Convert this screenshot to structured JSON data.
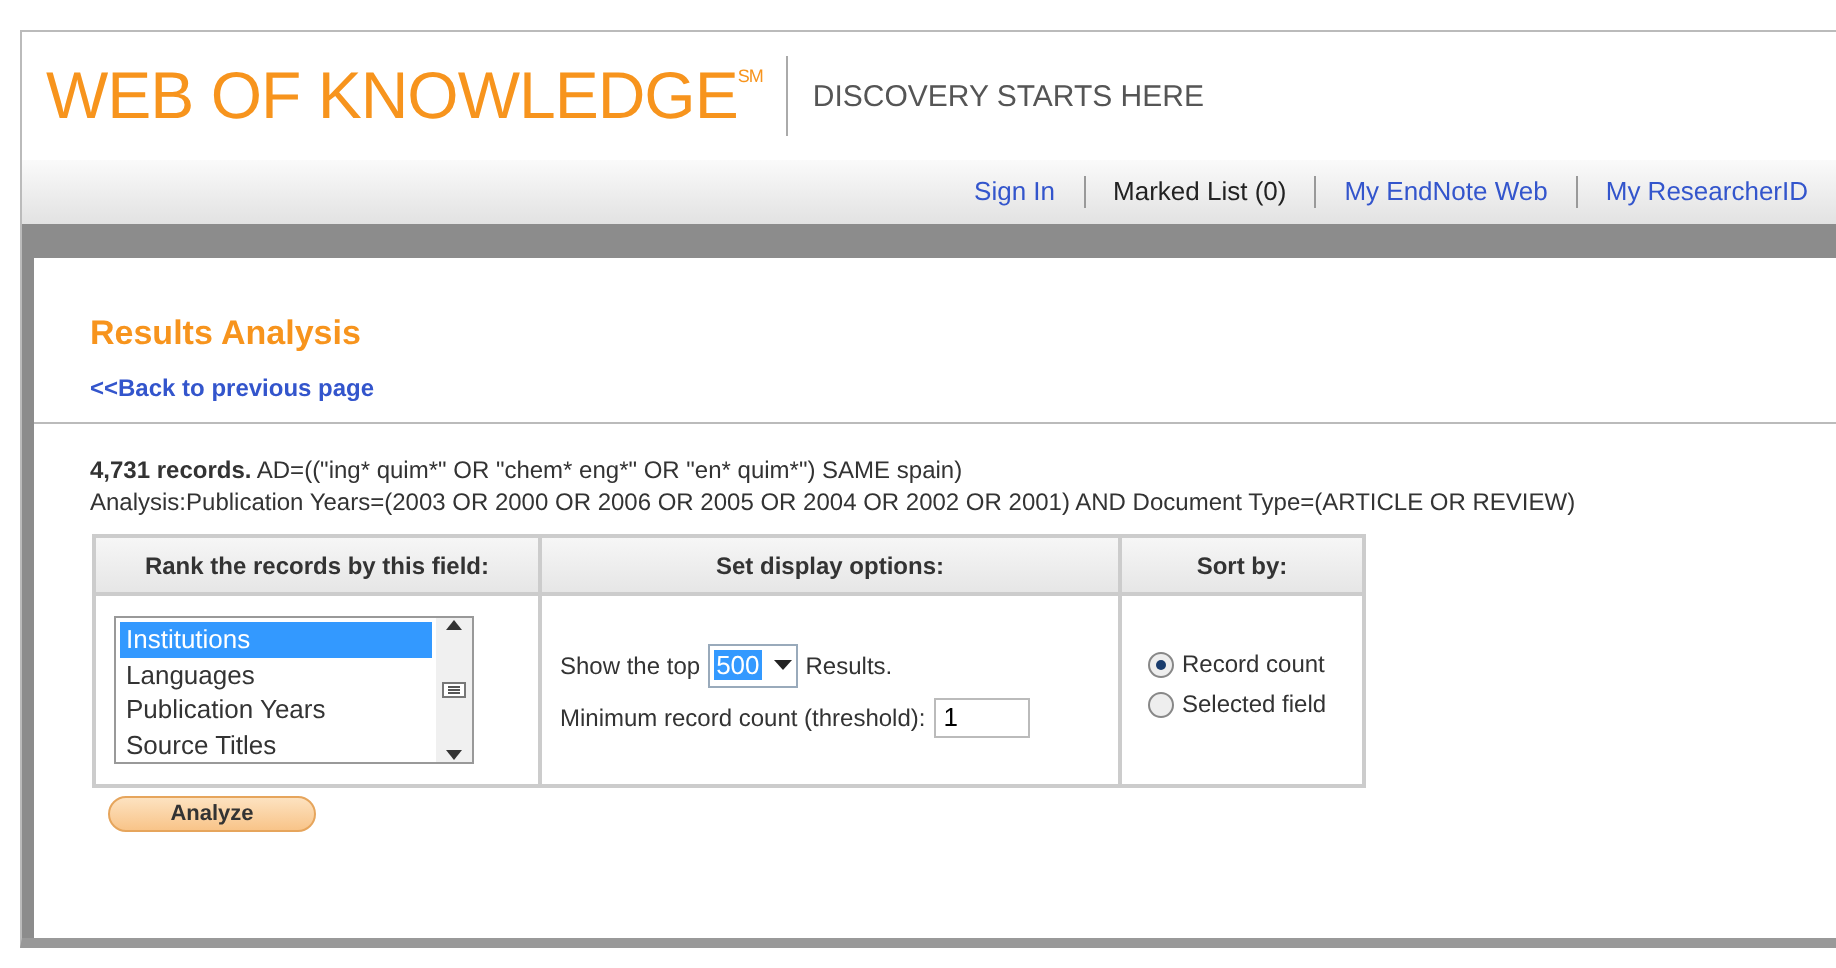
{
  "header": {
    "logo": "WEB OF KNOWLEDGE$^{SM}$",
    "tagline": "DISCOVERY STARTS HERE"
  },
  "nav": [
    {
      "label": "Sign In",
      "kind": "link"
    },
    {
      "label": "Marked List (0)",
      "kind": "text"
    },
    {
      "label": "My EndNote Web",
      "kind": "link"
    },
    {
      "label": "My ResearcherID",
      "kind": "link"
    }
  ],
  "page": {
    "title": "Results Analysis",
    "back_link": "<<Back to previous page",
    "summary": "**4,731 records.** AD=((\"ing* quim*\" OR \"chem* eng*\" OR \"en* quim*\") SAME spain)",
    "analysis": "Analysis:Publication Years=(2003 OR 2000 OR 2006 OR 2005 OR 2004 OR 2002 OR 2001) AND Document Type=(ARTICLE OR REVIEW)"
  },
  "form": {
    "columns": [
      "Rank the records by this field:",
      "Set display options:",
      "Sort by:"
    ],
    "fields": [
      {
        "label": "Institutions",
        "selected": true
      },
      {
        "label": "Languages",
        "selected": false
      },
      {
        "label": "Publication Years",
        "selected": false
      },
      {
        "label": "Source Titles",
        "selected": false
      }
    ],
    "show_top_label": "Show the top",
    "show_top_value": "500",
    "results_label": "Results.",
    "threshold_label": "Minimum record count (threshold):",
    "threshold_value": "1",
    "sort_options": [
      {
        "label": "Record count",
        "selected": true
      },
      {
        "label": "Selected field",
        "selected": false
      }
    ],
    "analyze_button": "Analyze"
  }
}
